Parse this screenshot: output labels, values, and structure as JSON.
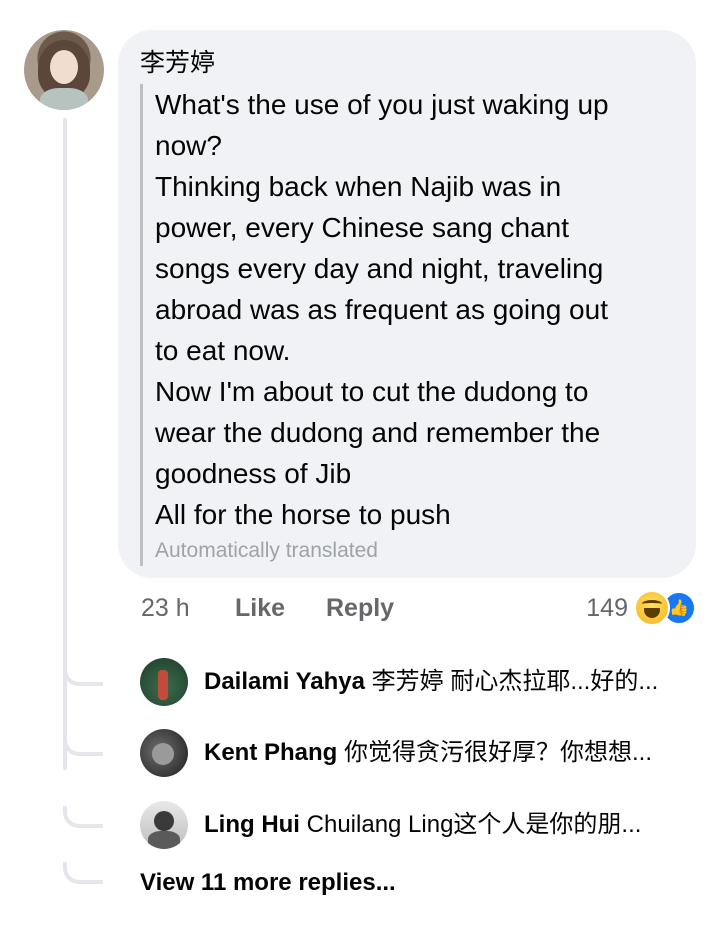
{
  "comment": {
    "author": "李芳婷",
    "lines": [
      "What's the use of you just waking up",
      "now?",
      "Thinking back when Najib was in",
      "power, every Chinese sang chant",
      "songs every day and night, traveling",
      "abroad was as frequent as going out",
      "to eat now.",
      "Now I'm about to cut the dudong to",
      "wear the dudong and remember the",
      "goodness of Jib",
      "All for the horse to push"
    ],
    "translated_note": "Automatically translated",
    "time": "23 h",
    "like_label": "Like",
    "reply_label": "Reply",
    "reaction_count": "149",
    "reaction_icons": [
      "haha-icon",
      "like-icon"
    ]
  },
  "replies": [
    {
      "name": "Dailami Yahya",
      "text": "李芳婷 耐心杰拉耶...好的..."
    },
    {
      "name": "Kent Phang",
      "text": "你觉得贪污很好厚？你想想..."
    },
    {
      "name": "Ling Hui",
      "text": "Chuilang  Ling这个人是你的朋..."
    }
  ],
  "view_more_label": "View 11 more replies...",
  "colors": {
    "bubble_bg": "#f0f2f5",
    "meta_text": "#65676b",
    "like_blue": "#1877f2",
    "haha_yellow": "#f7b125",
    "thread_line": "#e4e6eb"
  }
}
